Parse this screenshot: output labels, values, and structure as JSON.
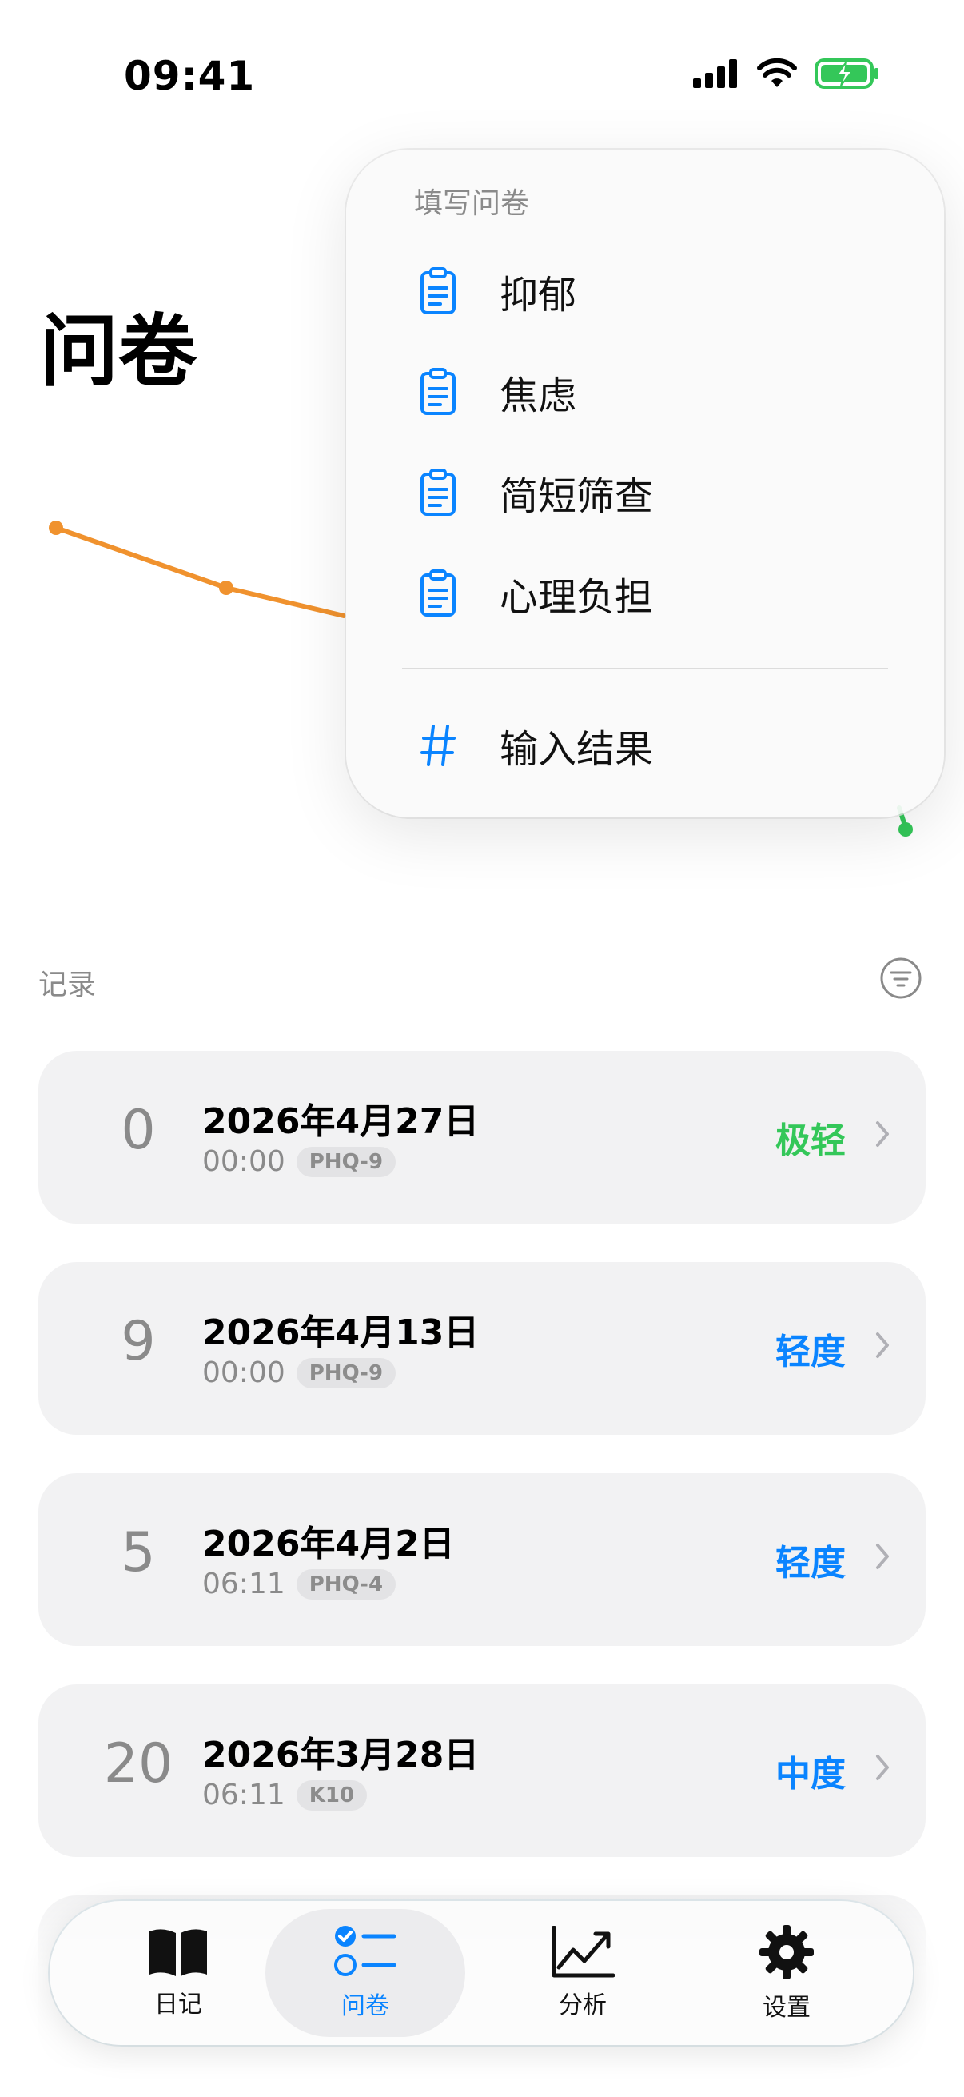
{
  "status": {
    "time": "09:41"
  },
  "page": {
    "title": "问卷"
  },
  "menu": {
    "header": "填写问卷",
    "items": [
      {
        "label": "抑郁",
        "icon": "clipboard-icon"
      },
      {
        "label": "焦虑",
        "icon": "clipboard-icon"
      },
      {
        "label": "简短筛查",
        "icon": "clipboard-icon"
      },
      {
        "label": "心理负担",
        "icon": "clipboard-icon"
      }
    ],
    "input": {
      "label": "输入结果",
      "icon": "hash-icon"
    }
  },
  "records": {
    "label": "记录",
    "items": [
      {
        "score": "0",
        "date": "2026年4月27日",
        "time": "00:00",
        "tag": "PHQ-9",
        "level": "极轻",
        "level_color": "#34c759"
      },
      {
        "score": "9",
        "date": "2026年4月13日",
        "time": "00:00",
        "tag": "PHQ-9",
        "level": "轻度",
        "level_color": "#0a84ff"
      },
      {
        "score": "5",
        "date": "2026年4月2日",
        "time": "06:11",
        "tag": "PHQ-4",
        "level": "轻度",
        "level_color": "#0a84ff"
      },
      {
        "score": "20",
        "date": "2026年3月28日",
        "time": "06:11",
        "tag": "K10",
        "level": "中度",
        "level_color": "#0a84ff"
      }
    ]
  },
  "tabs": [
    {
      "label": "日记",
      "icon": "book-icon"
    },
    {
      "label": "问卷",
      "icon": "checklist-icon",
      "active": true
    },
    {
      "label": "分析",
      "icon": "chart-icon"
    },
    {
      "label": "设置",
      "icon": "gear-icon"
    }
  ],
  "colors": {
    "accent": "#0a84ff",
    "chart_line": "#f0922e",
    "chart_end": "#34c759"
  }
}
